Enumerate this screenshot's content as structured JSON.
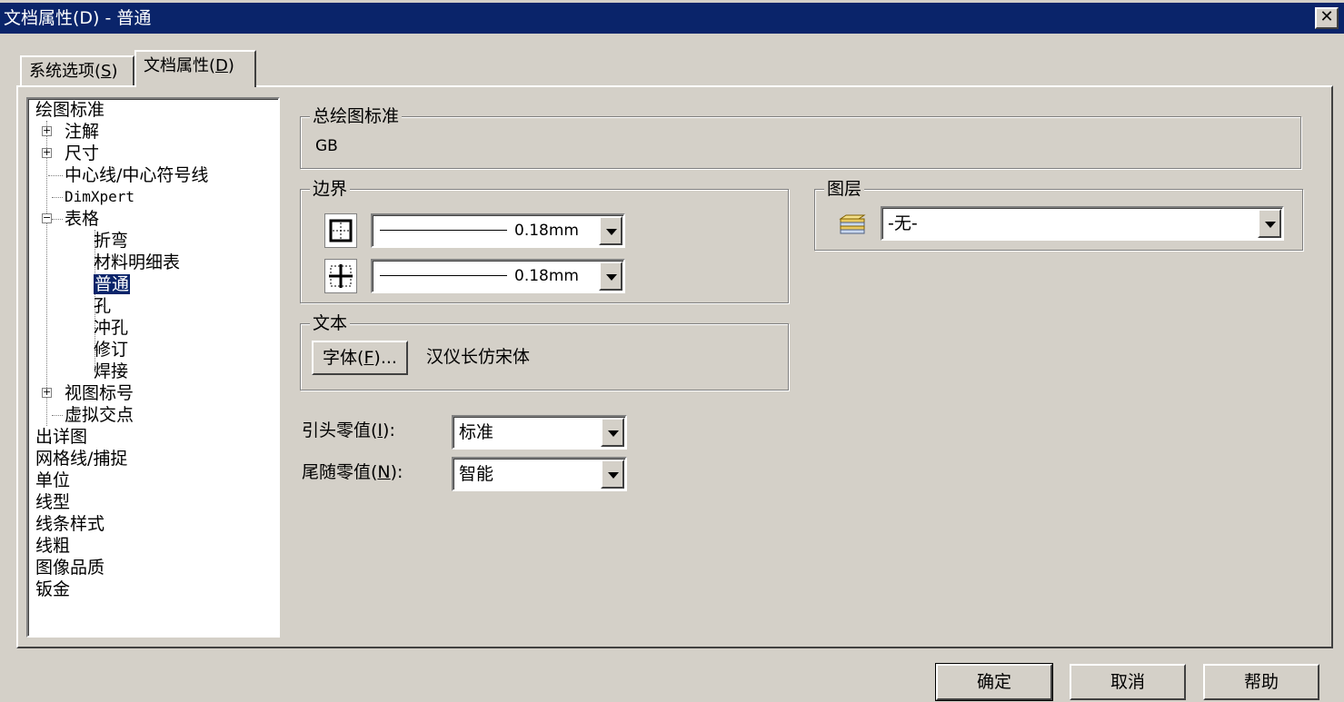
{
  "window": {
    "title": "文档属性(D) - 普通",
    "close": "✕"
  },
  "tabs": [
    {
      "label": "系统选项(",
      "mnemonic": "S",
      "suffix": ")"
    },
    {
      "label": "文档属性(",
      "mnemonic": "D",
      "suffix": ")"
    }
  ],
  "tree": {
    "items": [
      "绘图标准",
      "注解",
      "尺寸",
      "中心线/中心符号线",
      "DimXpert",
      "表格",
      "折弯",
      "材料明细表",
      "普通",
      "孔",
      "冲孔",
      "修订",
      "焊接",
      "视图标号",
      "虚拟交点",
      "出详图",
      "网格线/捕捉",
      "单位",
      "线型",
      "线条样式",
      "线粗",
      "图像品质",
      "钣金"
    ],
    "expanders": {
      "plus": "+",
      "minus": "−"
    }
  },
  "overall_standard": {
    "title": "总绘图标准",
    "value": "GB"
  },
  "border": {
    "title": "边界",
    "rows": [
      {
        "width": "0.18mm"
      },
      {
        "width": "0.18mm"
      }
    ]
  },
  "layer": {
    "title": "图层",
    "value": "-无-"
  },
  "text": {
    "title": "文本",
    "font_button": "字体(",
    "font_mnemonic": "F",
    "font_button_suffix": ")...",
    "font_name": "汉仪长仿宋体"
  },
  "leading_zeros": {
    "label": "引头零值(",
    "mnemonic": "I",
    "suffix": "):",
    "value": "标准"
  },
  "trailing_zeros": {
    "label": "尾随零值(",
    "mnemonic": "N",
    "suffix": "):",
    "value": "智能"
  },
  "buttons": {
    "ok": "确定",
    "cancel": "取消",
    "help": "帮助"
  }
}
